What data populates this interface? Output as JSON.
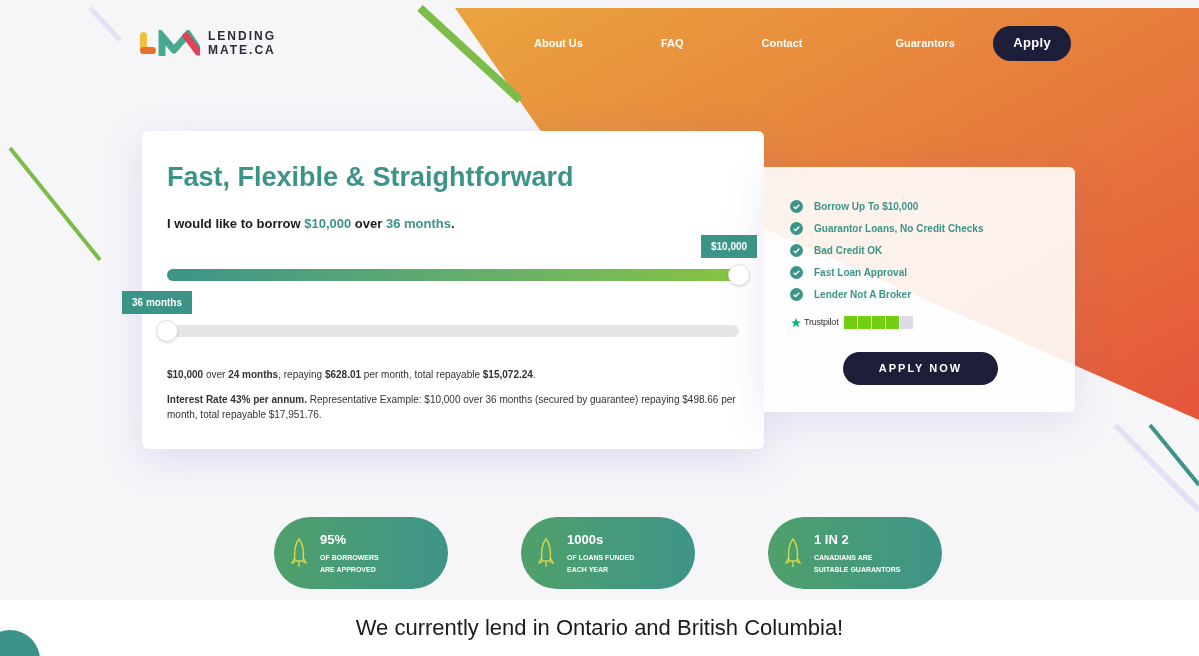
{
  "nav": {
    "logo": {
      "line1": "LENDING",
      "line2": "MATE.CA"
    },
    "links": [
      "About Us",
      "FAQ",
      "Contact",
      "Guarantors"
    ],
    "apply": "Apply"
  },
  "calculator": {
    "title": "Fast, Flexible & Straightforward",
    "sentence": [
      {
        "kind": "plain",
        "text": "I would like to borrow "
      },
      {
        "kind": "accent",
        "text": "$10,000"
      },
      {
        "kind": "plain",
        "text": " over "
      },
      {
        "kind": "accent",
        "text": "36 months"
      },
      {
        "kind": "plain",
        "text": "."
      }
    ],
    "sliders": [
      {
        "kind": "filled",
        "label": "$10,000",
        "level": 1
      },
      {
        "kind": "empty",
        "label": "36 months",
        "level": 0
      }
    ],
    "summary": "**$10,000** over **24 months**, repaying **$628.01** per month, total repayable **$15,072.24**.",
    "disclaimer": "**Interest Rate 43% per annum.** Representative Example: $10,000 over 36 months (secured by guarantee) repaying $498.66 per month, total repayable $17,951.76."
  },
  "features": [
    "Borrow Up To $10,000",
    "Guarantor Loans, No Credit Checks",
    "Bad Credit OK",
    "Fast Loan Approval",
    "Lender Not A Broker"
  ],
  "trustpilot": {
    "label": "Trustpilot",
    "stars": 4
  },
  "apply_now": "APPLY NOW",
  "stats": [
    {
      "value": "95%",
      "line1": "OF BORROWERS",
      "line2": "ARE APPROVED"
    },
    {
      "value": "1000s",
      "line1": "OF LOANS FUNDED",
      "line2": "EACH YEAR"
    },
    {
      "value": "1 IN 2",
      "line1": "CANADIANS ARE",
      "line2": "SUITABLE GUARANTORS"
    }
  ],
  "heading": "We currently lend in Ontario and British Columbia!"
}
